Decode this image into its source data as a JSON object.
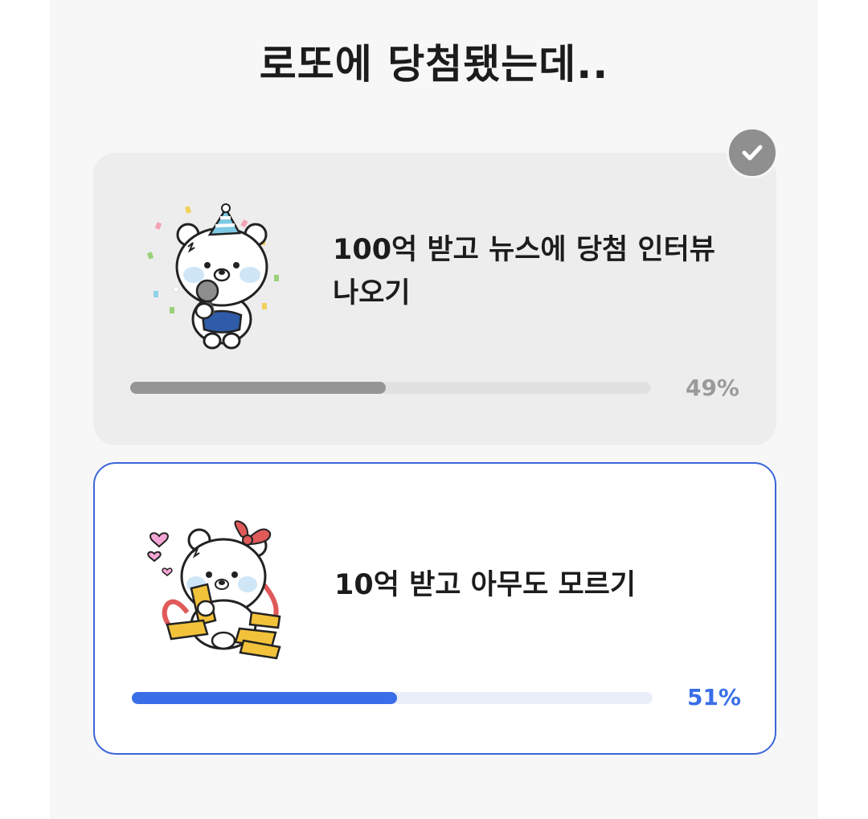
{
  "question": {
    "title": "로또에 당첨됐는데.."
  },
  "options": [
    {
      "text": "100억 받고 뉴스에 당첨 인터뷰 나오기",
      "percent_label": "49%",
      "percent": 49,
      "selected": true,
      "sticker_icon": "party-bear-with-microphone-icon",
      "bar_color": "#959595"
    },
    {
      "text": "10억 받고 아무도 모르기",
      "percent_label": "51%",
      "percent": 51,
      "selected": false,
      "sticker_icon": "bear-with-gold-bars-icon",
      "bar_color": "#3a6ee8",
      "border_color": "#3a66d8"
    }
  ]
}
